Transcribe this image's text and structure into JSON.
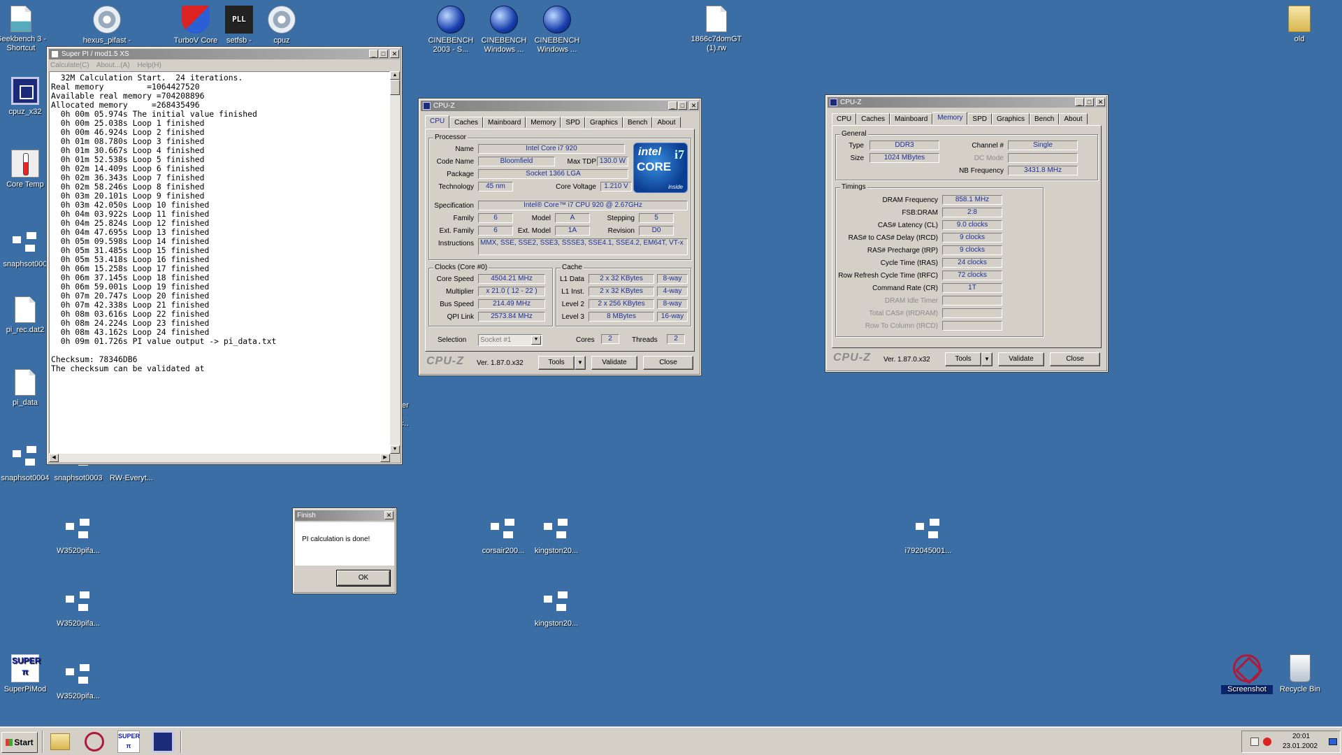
{
  "desktop": {
    "icons": [
      {
        "id": "geekbench",
        "label": "Geekbench 3 - Shortcut",
        "icon": "chart-icon"
      },
      {
        "id": "hexus",
        "label": "hexus_pifast -",
        "icon": "gear-icon"
      },
      {
        "id": "turbov",
        "label": "TurboV Core",
        "icon": "shield-icon"
      },
      {
        "id": "setfsb",
        "label": "setfsb -",
        "icon": "pll-icon"
      },
      {
        "id": "cpuz1",
        "label": "cpuz",
        "icon": "gear-icon"
      },
      {
        "id": "cb2003",
        "label": "CINEBENCH 2003 - S...",
        "icon": "cinebench-icon"
      },
      {
        "id": "cbwin1",
        "label": "CINEBENCH Windows ...",
        "icon": "cinebench-icon"
      },
      {
        "id": "cbwin2",
        "label": "CINEBENCH Windows ...",
        "icon": "cinebench-icon"
      },
      {
        "id": "rwfile",
        "label": "1866c7domGT (1).rw",
        "icon": "document-icon"
      },
      {
        "id": "old",
        "label": "old",
        "icon": "folder-icon"
      },
      {
        "id": "cpuzx32",
        "label": "cpuz_x32",
        "icon": "chip-icon"
      },
      {
        "id": "coretemp",
        "label": "Core Temp",
        "icon": "thermometer-icon"
      },
      {
        "id": "snap0000",
        "label": "snaphsot000",
        "icon": "network-icon"
      },
      {
        "id": "pirec",
        "label": "pi_rec.dat2",
        "icon": "document-icon"
      },
      {
        "id": "pidata",
        "label": "pi_data",
        "icon": "document-icon"
      },
      {
        "id": "snap0004",
        "label": "snaphsot0004",
        "icon": "network-icon"
      },
      {
        "id": "snap0003",
        "label": "snaphsot0003",
        "icon": "network-icon"
      },
      {
        "id": "rweveryt",
        "label": "RW-Everyt...",
        "icon": "network-icon"
      },
      {
        "id": "w3520a",
        "label": "W3520pifa...",
        "icon": "network-icon"
      },
      {
        "id": "corsair",
        "label": "corsair200...",
        "icon": "network-icon"
      },
      {
        "id": "kingston1",
        "label": "kingston20...",
        "icon": "network-icon"
      },
      {
        "id": "i792",
        "label": "i792045001...",
        "icon": "network-icon"
      },
      {
        "id": "w3520b",
        "label": "W3520pifa...",
        "icon": "network-icon"
      },
      {
        "id": "kingston2",
        "label": "kingston20...",
        "icon": "network-icon"
      },
      {
        "id": "superpimod",
        "label": "SuperPiMod",
        "icon": "superpi-icon"
      },
      {
        "id": "w3520c",
        "label": "W3520pifa...",
        "icon": "network-icon"
      },
      {
        "id": "screenshot",
        "label": "Screenshot",
        "icon": "screenshot-icon"
      },
      {
        "id": "recyclebin",
        "label": "Recycle Bin",
        "icon": "recycle-bin-icon"
      }
    ],
    "partial_label": "ter - cut"
  },
  "superpi": {
    "title": "Super PI / mod1.5 XS",
    "menu": [
      "Calculate(C)",
      "About...(A)",
      "Help(H)"
    ],
    "lines": [
      "  32M Calculation Start.  24 iterations.",
      "Real memory         =1064427520",
      "Available real memory =704208896",
      "Allocated memory     =268435496",
      "  0h 00m 05.974s The initial value finished",
      "  0h 00m 25.038s Loop 1 finished",
      "  0h 00m 46.924s Loop 2 finished",
      "  0h 01m 08.780s Loop 3 finished",
      "  0h 01m 30.667s Loop 4 finished",
      "  0h 01m 52.538s Loop 5 finished",
      "  0h 02m 14.409s Loop 6 finished",
      "  0h 02m 36.343s Loop 7 finished",
      "  0h 02m 58.246s Loop 8 finished",
      "  0h 03m 20.101s Loop 9 finished",
      "  0h 03m 42.050s Loop 10 finished",
      "  0h 04m 03.922s Loop 11 finished",
      "  0h 04m 25.824s Loop 12 finished",
      "  0h 04m 47.695s Loop 13 finished",
      "  0h 05m 09.598s Loop 14 finished",
      "  0h 05m 31.485s Loop 15 finished",
      "  0h 05m 53.418s Loop 16 finished",
      "  0h 06m 15.258s Loop 17 finished",
      "  0h 06m 37.145s Loop 18 finished",
      "  0h 06m 59.001s Loop 19 finished",
      "  0h 07m 20.747s Loop 20 finished",
      "  0h 07m 42.338s Loop 21 finished",
      "  0h 08m 03.616s Loop 22 finished",
      "  0h 08m 24.224s Loop 23 finished",
      "  0h 08m 43.162s Loop 24 finished",
      "  0h 09m 01.726s PI value output -> pi_data.txt",
      "",
      "Checksum: 78346DB6",
      "The checksum can be validated at"
    ]
  },
  "cpuz_cpu": {
    "title": "CPU-Z",
    "tabs": [
      "CPU",
      "Caches",
      "Mainboard",
      "Memory",
      "SPD",
      "Graphics",
      "Bench",
      "About"
    ],
    "active_tab": "CPU",
    "processor_group": "Processor",
    "name_label": "Name",
    "name": "Intel Core i7 920",
    "codename_label": "Code Name",
    "codename": "Bloomfield",
    "maxtdp_label": "Max TDP",
    "maxtdp": "130.0 W",
    "package_label": "Package",
    "package": "Socket 1366 LGA",
    "technology_label": "Technology",
    "technology": "45 nm",
    "corevoltage_label": "Core Voltage",
    "corevoltage": "1.210 V",
    "spec_label": "Specification",
    "spec": "Intel® Core™ i7 CPU      920  @ 2.67GHz",
    "family_label": "Family",
    "family": "6",
    "model_label": "Model",
    "model": "A",
    "stepping_label": "Stepping",
    "stepping": "5",
    "extfamily_label": "Ext. Family",
    "extfamily": "6",
    "extmodel_label": "Ext. Model",
    "extmodel": "1A",
    "revision_label": "Revision",
    "revision": "D0",
    "instructions_label": "Instructions",
    "instructions": "MMX, SSE, SSE2, SSE3, SSSE3, SSE4.1, SSE4.2, EM64T, VT-x",
    "logo": {
      "brand": "intel",
      "line1": "CORE",
      "badge": "i7",
      "tag": "inside"
    },
    "clocks_group": "Clocks (Core #0)",
    "corespeed_label": "Core Speed",
    "corespeed": "4504.21 MHz",
    "multiplier_label": "Multiplier",
    "multiplier": "x 21.0 ( 12 - 22 )",
    "busspeed_label": "Bus Speed",
    "busspeed": "214.49 MHz",
    "qpi_label": "QPI Link",
    "qpi": "2573.84 MHz",
    "cache_group": "Cache",
    "l1d_label": "L1 Data",
    "l1d": "2 x 32 KBytes",
    "l1d_way": "8-way",
    "l1i_label": "L1 Inst.",
    "l1i": "2 x 32 KBytes",
    "l1i_way": "4-way",
    "l2_label": "Level 2",
    "l2": "2 x 256 KBytes",
    "l2_way": "8-way",
    "l3_label": "Level 3",
    "l3": "8 MBytes",
    "l3_way": "16-way",
    "selection_label": "Selection",
    "selection": "Socket #1",
    "cores_label": "Cores",
    "cores": "2",
    "threads_label": "Threads",
    "threads": "2",
    "brand": "CPU-Z",
    "version": "Ver. 1.87.0.x32",
    "tools": "Tools",
    "validate": "Validate",
    "close": "Close"
  },
  "cpuz_mem": {
    "title": "CPU-Z",
    "tabs": [
      "CPU",
      "Caches",
      "Mainboard",
      "Memory",
      "SPD",
      "Graphics",
      "Bench",
      "About"
    ],
    "active_tab": "Memory",
    "general_group": "General",
    "type_label": "Type",
    "type": "DDR3",
    "size_label": "Size",
    "size": "1024 MBytes",
    "channel_label": "Channel #",
    "channel": "Single",
    "dcmode_label": "DC Mode",
    "dcmode": "",
    "nbfreq_label": "NB Frequency",
    "nbfreq": "3431.8 MHz",
    "timings_group": "Timings",
    "timings": [
      {
        "label": "DRAM Frequency",
        "value": "858.1 MHz",
        "disabled": false
      },
      {
        "label": "FSB:DRAM",
        "value": "2:8",
        "disabled": false
      },
      {
        "label": "CAS# Latency (CL)",
        "value": "9.0 clocks",
        "disabled": false
      },
      {
        "label": "RAS# to CAS# Delay (tRCD)",
        "value": "9 clocks",
        "disabled": false
      },
      {
        "label": "RAS# Precharge (tRP)",
        "value": "9 clocks",
        "disabled": false
      },
      {
        "label": "Cycle Time (tRAS)",
        "value": "24 clocks",
        "disabled": false
      },
      {
        "label": "Row Refresh Cycle Time (tRFC)",
        "value": "72 clocks",
        "disabled": false
      },
      {
        "label": "Command Rate (CR)",
        "value": "1T",
        "disabled": false
      },
      {
        "label": "DRAM Idle Timer",
        "value": "",
        "disabled": true
      },
      {
        "label": "Total CAS# (tRDRAM)",
        "value": "",
        "disabled": true
      },
      {
        "label": "Row To Column (tRCD)",
        "value": "",
        "disabled": true
      }
    ],
    "brand": "CPU-Z",
    "version": "Ver. 1.87.0.x32",
    "tools": "Tools",
    "validate": "Validate",
    "close": "Close"
  },
  "finish_dialog": {
    "title": "Finish",
    "message": "PI calculation is done!",
    "ok": "OK"
  },
  "taskbar": {
    "start": "Start",
    "clock_time": "20:01",
    "clock_date": "23.01.2002"
  }
}
